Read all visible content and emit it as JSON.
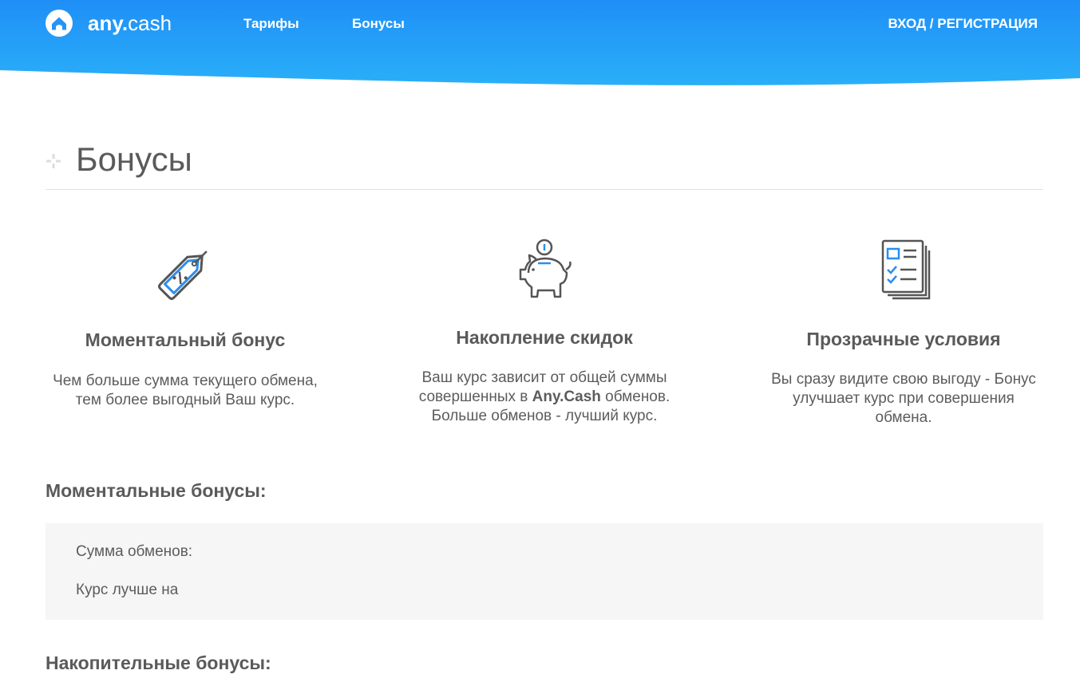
{
  "header": {
    "logo": {
      "brand_bold": "any.",
      "brand_light": "cash"
    },
    "nav": {
      "tariffs": "Тарифы",
      "bonuses": "Бонусы",
      "login": "ВХОД / РЕГИСТРАЦИЯ"
    },
    "colors": {
      "gradient_start": "#1f8ff7",
      "gradient_end": "#29b0f8",
      "text": "#ffffff"
    }
  },
  "page": {
    "title": "Бонусы"
  },
  "features": [
    {
      "icon": "price-tag-percent-icon",
      "title": "Моментальный бонус",
      "text": "Чем больше сумма текущего обмена, тем более выгодный Ваш курс."
    },
    {
      "icon": "piggy-bank-icon",
      "title": "Накопление скидок",
      "text_before": "Ваш курс зависит от общей суммы совершенных в ",
      "brand": "Any.Cash",
      "text_after": " обменов. Больше обменов - лучший курс."
    },
    {
      "icon": "document-checklist-icon",
      "title": "Прозрачные условия",
      "text": "Вы сразу видите свою выгоду - Бонус улучшает курс при совершения обмена."
    }
  ],
  "instant_bonuses": {
    "title": "Моментальные бонусы:",
    "rows": [
      "Сумма обменов:",
      "Курс лучше на"
    ]
  },
  "cumulative_bonuses": {
    "title": "Накопительные бонусы:"
  },
  "accent_color": "#2a8ef0"
}
